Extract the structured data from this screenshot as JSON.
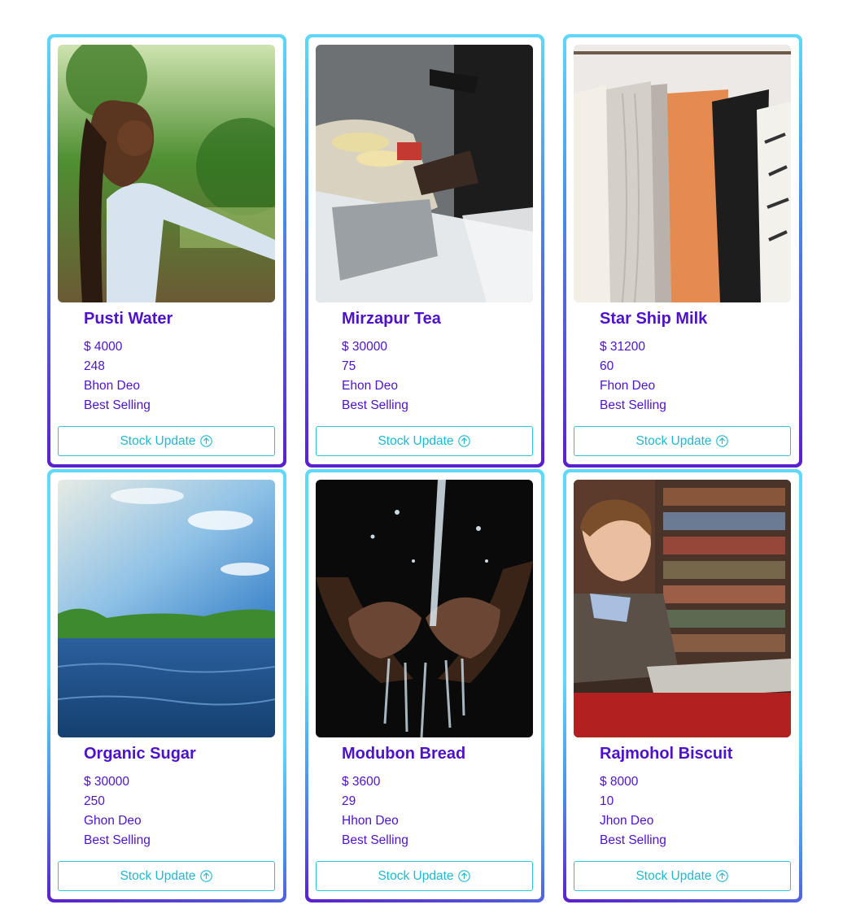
{
  "colors": {
    "accent": "#4d12c9",
    "button": "#1fb8cf",
    "border_light": "#5fd8fa",
    "border_dark": "#5b1fcc"
  },
  "products": [
    {
      "name": "Pusti Water",
      "price": "$ 4000",
      "quantity": "248",
      "supplier": "Bhon Deo",
      "tag": "Best Selling",
      "button_label": "Stock Update"
    },
    {
      "name": "Mirzapur Tea",
      "price": "$ 30000",
      "quantity": "75",
      "supplier": "Ehon Deo",
      "tag": "Best Selling",
      "button_label": "Stock Update"
    },
    {
      "name": "Star Ship Milk",
      "price": "$ 31200",
      "quantity": "60",
      "supplier": "Fhon Deo",
      "tag": "Best Selling",
      "button_label": "Stock Update"
    },
    {
      "name": "Organic Sugar",
      "price": "$ 30000",
      "quantity": "250",
      "supplier": "Ghon Deo",
      "tag": "Best Selling",
      "button_label": "Stock Update"
    },
    {
      "name": "Modubon Bread",
      "price": "$ 3600",
      "quantity": "29",
      "supplier": "Hhon Deo",
      "tag": "Best Selling",
      "button_label": "Stock Update"
    },
    {
      "name": "Rajmohol Biscuit",
      "price": "$ 8000",
      "quantity": "10",
      "supplier": "Jhon Deo",
      "tag": "Best Selling",
      "button_label": "Stock Update"
    }
  ],
  "icons": {
    "button_icon": "arrow-up-circle-icon"
  }
}
